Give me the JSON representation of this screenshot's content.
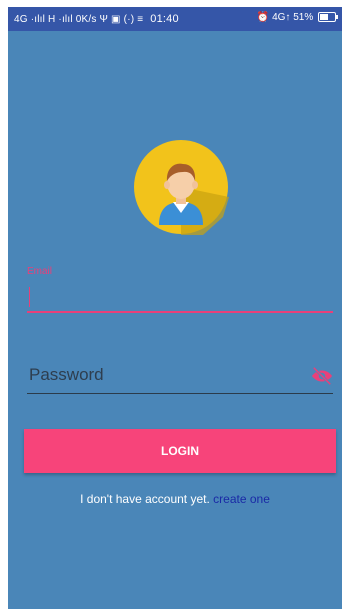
{
  "status_bar": {
    "left": "4G ·ılıl H ·ılıl 0K/s Ψ ▣ (·) ≡",
    "time": "01:40",
    "right": "⏰ 4G↑ 51%"
  },
  "login": {
    "email_label": "Email",
    "email_value": "",
    "password_placeholder": "Password",
    "login_button": "LOGIN",
    "no_account_text": "I don't have account yet.",
    "create_link": "create one"
  },
  "icons": {
    "avatar": "user-avatar-icon",
    "password_toggle": "eye-off-icon",
    "battery": "battery-icon"
  },
  "colors": {
    "background": "#4a86b8",
    "status_bar": "#3556a8",
    "accent": "#e8407a",
    "button": "#f7447a",
    "link": "#1a2aa6"
  }
}
